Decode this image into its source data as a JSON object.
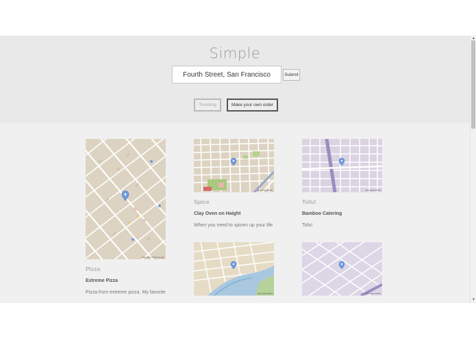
{
  "header": {
    "title": "Simple"
  },
  "search": {
    "value": "Fourth Street, San Francisco",
    "submit_label": "Submit"
  },
  "nav": {
    "trending_label": "Trending",
    "order_label": "Make your own order"
  },
  "cards": [
    {
      "category": "Pizza",
      "name": "Extreme Pizza",
      "description": "Pizza from extreme pizza. My favorite",
      "map_credit": "Map data ©2015 Google"
    },
    {
      "category": "Spice",
      "name": "Clay Oven on Haight",
      "description": "When you need to spicen up your life",
      "map_credit": "Map data ©2015"
    },
    {
      "category": "Tofu!",
      "name": "Bamboo Catering",
      "description": "Tofu!",
      "map_credit": "Map data ©2015"
    },
    {
      "category": "",
      "name": "",
      "description": "",
      "map_credit": "Map data ©2015"
    },
    {
      "category": "",
      "name": "",
      "description": "",
      "map_credit": "Map data ©2015"
    }
  ],
  "colors": {
    "hero_bg": "#e9e9e9",
    "page_bg": "#f0f0f0",
    "map_road": "#ffffff",
    "map_tan": "#ddd3c2",
    "map_lavender": "#d9d3e2",
    "map_pin": "#6f9be0"
  },
  "icons": {
    "map_pin": "map-pin-icon",
    "scroll_up": "scroll-up-arrow-icon",
    "scroll_down": "scroll-down-arrow-icon"
  }
}
